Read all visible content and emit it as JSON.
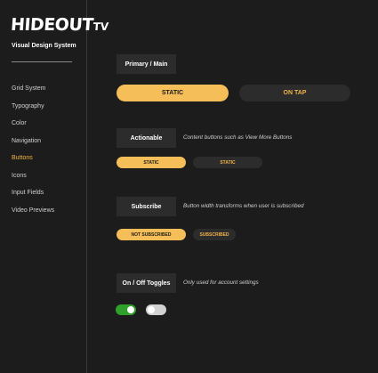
{
  "brand": {
    "logo_main": "HIDEOUT",
    "logo_suffix": "TV",
    "subtitle": "Visual Design System"
  },
  "sidebar": {
    "items": [
      {
        "label": "Grid System",
        "active": false
      },
      {
        "label": "Typography",
        "active": false
      },
      {
        "label": "Color",
        "active": false
      },
      {
        "label": "Navigation",
        "active": false
      },
      {
        "label": "Buttons",
        "active": true
      },
      {
        "label": "Icons",
        "active": false
      },
      {
        "label": "Input Fields",
        "active": false
      },
      {
        "label": "Video Previews",
        "active": false
      }
    ]
  },
  "sections": {
    "primary": {
      "title": "Primary / Main",
      "static_label": "STATIC",
      "tap_label": "ON TAP"
    },
    "actionable": {
      "title": "Actionable",
      "description": "Content buttons such as View More Buttons",
      "static_label": "STATIC",
      "tap_label": "STATIC"
    },
    "subscribe": {
      "title": "Subscribe",
      "description": "Button width transforms when user is subscribed",
      "not_subscribed_label": "NOT SUBSCRIBED",
      "subscribed_label": "SUBSCRIBED"
    },
    "toggles": {
      "title": "On / Off Toggles",
      "description": "Only used for account settings",
      "on_state": true,
      "off_state": false
    }
  },
  "colors": {
    "background": "#1c1c1c",
    "accent": "#f6be58",
    "button_dark": "#2c2c2c",
    "toggle_on": "#2fa02a",
    "toggle_off": "#d2d2d2"
  },
  "icons": {
    "toggle_knob": "circle"
  }
}
